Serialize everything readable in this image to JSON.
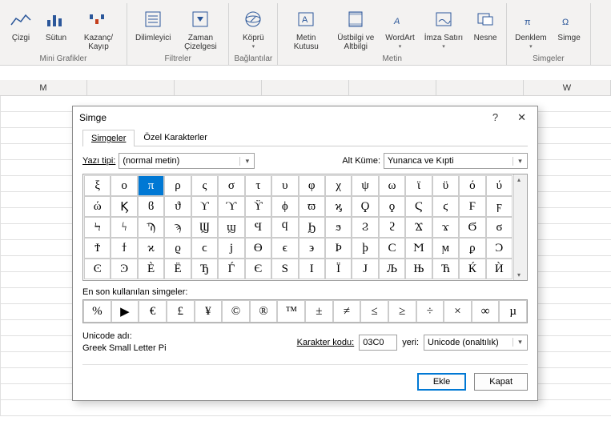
{
  "ribbon": {
    "groups": [
      {
        "title": "Mini Grafikler",
        "items": [
          {
            "label": "Çizgi",
            "icon": "line-spark"
          },
          {
            "label": "Sütun",
            "icon": "col-spark"
          },
          {
            "label": "Kazanç/\nKayıp",
            "icon": "winloss-spark"
          }
        ]
      },
      {
        "title": "Filtreler",
        "items": [
          {
            "label": "Dilimleyici",
            "icon": "slicer"
          },
          {
            "label": "Zaman\nÇizelgesi",
            "icon": "timeline"
          }
        ]
      },
      {
        "title": "Bağlantılar",
        "items": [
          {
            "label": "Köprü",
            "icon": "link",
            "dd": true
          }
        ]
      },
      {
        "title": "Metin",
        "items": [
          {
            "label": "Metin\nKutusu",
            "icon": "textbox"
          },
          {
            "label": "Üstbilgi\nve Altbilgi",
            "icon": "headerfooter"
          },
          {
            "label": "WordArt",
            "icon": "wordart",
            "dd": true
          },
          {
            "label": "İmza\nSatırı",
            "icon": "sig",
            "dd": true
          },
          {
            "label": "Nesne",
            "icon": "object"
          }
        ]
      },
      {
        "title": "Simgeler",
        "items": [
          {
            "label": "Denklem",
            "icon": "equation",
            "dd": true
          },
          {
            "label": "Simge",
            "icon": "omega"
          }
        ]
      }
    ]
  },
  "columns": [
    "M",
    "",
    "",
    "",
    "",
    "",
    "W"
  ],
  "dialog": {
    "title": "Simge",
    "help": "?",
    "close": "✕",
    "tabs": {
      "symbols": "Simgeler",
      "special": "Özel Karakterler"
    },
    "font_label": "Yazı tipi:",
    "font_value": "(normal metin)",
    "subset_label": "Alt Küme:",
    "subset_value": "Yunanca ve Kıpti",
    "grid": [
      [
        "ξ",
        "ο",
        "π",
        "ρ",
        "ς",
        "σ",
        "τ",
        "υ",
        "φ",
        "χ",
        "ψ",
        "ω",
        "ϊ",
        "ϋ",
        "ό",
        "ύ"
      ],
      [
        "ώ",
        "Ϗ",
        "ϐ",
        "ϑ",
        "ϒ",
        "ϓ",
        "ϔ",
        "ϕ",
        "ϖ",
        "ϗ",
        "Ϙ",
        "ϙ",
        "Ϛ",
        "ϛ",
        "Ϝ",
        "ϝ"
      ],
      [
        "Ϟ",
        "ϟ",
        "Ϡ",
        "ϡ",
        "Ϣ",
        "ϣ",
        "Ϥ",
        "ϥ",
        "Ϧ",
        "ϧ",
        "Ϩ",
        "ϩ",
        "Ϫ",
        "ϫ",
        "Ϭ",
        "ϭ"
      ],
      [
        "Ϯ",
        "ϯ",
        "ϰ",
        "ϱ",
        "ϲ",
        "ϳ",
        "ϴ",
        "ϵ",
        "϶",
        "Ϸ",
        "ϸ",
        "Ϲ",
        "Ϻ",
        "ϻ",
        "ϼ",
        "Ͻ"
      ],
      [
        "Ͼ",
        "Ͽ",
        "Ѐ",
        "Ё",
        "Ђ",
        "Ѓ",
        "Є",
        "Ѕ",
        "І",
        "Ї",
        "Ј",
        "Љ",
        "Њ",
        "Ћ",
        "Ќ",
        "Ѝ"
      ]
    ],
    "selected": [
      0,
      2
    ],
    "recent_label": "En son kullanılan simgeler:",
    "recent": [
      "%",
      "▶",
      "€",
      "£",
      "¥",
      "©",
      "®",
      "™",
      "±",
      "≠",
      "≤",
      "≥",
      "÷",
      "×",
      "∞",
      "µ"
    ],
    "unicode_name_label": "Unicode adı:",
    "unicode_name": "Greek Small Letter Pi",
    "code_label": "Karakter kodu:",
    "code_value": "03C0",
    "from_label": "yeri:",
    "from_value": "Unicode (onaltılık)",
    "btn_insert": "Ekle",
    "btn_close": "Kapat"
  }
}
